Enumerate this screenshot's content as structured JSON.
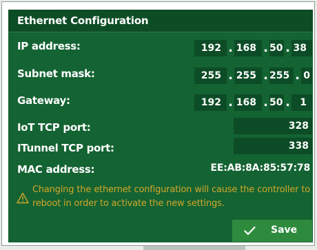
{
  "title": "Ethernet Configuration",
  "fields": {
    "ip": {
      "label": "IP address:",
      "octets": [
        "192",
        "168",
        "50",
        "38"
      ]
    },
    "subnet": {
      "label": "Subnet mask:",
      "octets": [
        "255",
        "255",
        "255",
        "0"
      ]
    },
    "gateway": {
      "label": "Gateway:",
      "octets": [
        "192",
        "168",
        "50",
        "1"
      ]
    },
    "iot_port": {
      "label": "IoT TCP port:",
      "value": "328"
    },
    "itunnel_port": {
      "label": "ITunnel TCP port:",
      "value": "338"
    },
    "mac": {
      "label": "MAC address:",
      "value": "EE:AB:8A:85:57:78"
    }
  },
  "dot_separator": ".",
  "warning": {
    "icon": "warning-triangle-icon",
    "text": "Changing the ethernet configuration will cause the controller to reboot in order to activate the new settings."
  },
  "save_button": {
    "label": "Save",
    "icon": "checkmark-icon"
  },
  "colors": {
    "panel": "#146333",
    "title_bar": "#0d4d26",
    "field_bg": "#0c4c26",
    "warning_text": "#d2a72a",
    "save_button": "#2e8b3e"
  }
}
